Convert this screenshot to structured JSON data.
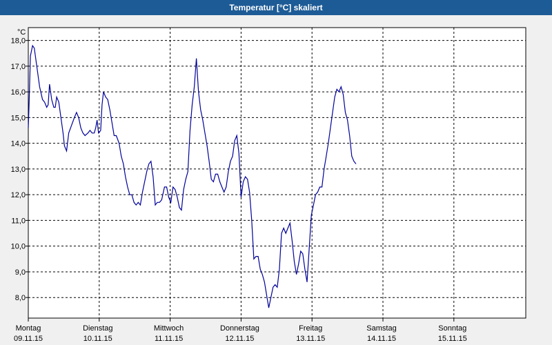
{
  "window": {
    "title": "Temperatur [°C] skaliert"
  },
  "colors": {
    "line": "#000099",
    "titlebar": "#1d5b96",
    "grid": "#000000",
    "background": "#f0f0f0"
  },
  "chart_data": {
    "type": "line",
    "title": "Temperatur [°C] skaliert",
    "ylabel": "°C",
    "ylim": [
      7.2,
      18.5
    ],
    "yticks": [
      {
        "value": 8,
        "label": "8,0"
      },
      {
        "value": 9,
        "label": "9,0"
      },
      {
        "value": 10,
        "label": "10,0"
      },
      {
        "value": 11,
        "label": "11,0"
      },
      {
        "value": 12,
        "label": "12,0"
      },
      {
        "value": 13,
        "label": "13,0"
      },
      {
        "value": 14,
        "label": "14,0"
      },
      {
        "value": 15,
        "label": "15,0"
      },
      {
        "value": 16,
        "label": "16,0"
      },
      {
        "value": 17,
        "label": "17,0"
      },
      {
        "value": 18,
        "label": "18,0"
      }
    ],
    "xlim": [
      0,
      7
    ],
    "x_unit": "days from 09.11.15 00:00",
    "xticks": [
      {
        "value": 0,
        "day": "Montag",
        "date": "09.11.15"
      },
      {
        "value": 1,
        "day": "Dienstag",
        "date": "10.11.15"
      },
      {
        "value": 2,
        "day": "Mittwoch",
        "date": "11.11.15"
      },
      {
        "value": 3,
        "day": "Donnerstag",
        "date": "12.11.15"
      },
      {
        "value": 4,
        "day": "Freitag",
        "date": "13.11.15"
      },
      {
        "value": 5,
        "day": "Samstag",
        "date": "14.11.15"
      },
      {
        "value": 6,
        "day": "Sonntag",
        "date": "15.11.15"
      }
    ],
    "grid": true,
    "series": [
      {
        "points": [
          [
            0.0,
            14.6
          ],
          [
            0.01,
            15.4
          ],
          [
            0.03,
            17.4
          ],
          [
            0.06,
            17.8
          ],
          [
            0.085,
            17.7
          ],
          [
            0.12,
            17.0
          ],
          [
            0.16,
            16.2
          ],
          [
            0.2,
            15.7
          ],
          [
            0.23,
            15.6
          ],
          [
            0.26,
            15.4
          ],
          [
            0.28,
            15.5
          ],
          [
            0.3,
            16.3
          ],
          [
            0.33,
            15.7
          ],
          [
            0.36,
            15.4
          ],
          [
            0.38,
            15.4
          ],
          [
            0.4,
            15.8
          ],
          [
            0.43,
            15.6
          ],
          [
            0.46,
            15.0
          ],
          [
            0.49,
            14.4
          ],
          [
            0.51,
            13.9
          ],
          [
            0.54,
            13.7
          ],
          [
            0.57,
            14.4
          ],
          [
            0.61,
            14.7
          ],
          [
            0.65,
            15.0
          ],
          [
            0.68,
            15.2
          ],
          [
            0.71,
            15.0
          ],
          [
            0.74,
            14.6
          ],
          [
            0.77,
            14.4
          ],
          [
            0.8,
            14.3
          ],
          [
            0.84,
            14.4
          ],
          [
            0.87,
            14.5
          ],
          [
            0.9,
            14.4
          ],
          [
            0.93,
            14.4
          ],
          [
            0.95,
            14.6
          ],
          [
            0.97,
            14.9
          ],
          [
            0.99,
            14.4
          ],
          [
            1.02,
            14.5
          ],
          [
            1.04,
            15.5
          ],
          [
            1.06,
            16.0
          ],
          [
            1.09,
            15.8
          ],
          [
            1.12,
            15.7
          ],
          [
            1.15,
            15.3
          ],
          [
            1.18,
            14.8
          ],
          [
            1.21,
            14.3
          ],
          [
            1.24,
            14.3
          ],
          [
            1.28,
            14.0
          ],
          [
            1.31,
            13.5
          ],
          [
            1.34,
            13.2
          ],
          [
            1.37,
            12.7
          ],
          [
            1.4,
            12.3
          ],
          [
            1.43,
            12.0
          ],
          [
            1.46,
            12.0
          ],
          [
            1.49,
            11.7
          ],
          [
            1.52,
            11.6
          ],
          [
            1.55,
            11.7
          ],
          [
            1.58,
            11.6
          ],
          [
            1.61,
            12.1
          ],
          [
            1.64,
            12.5
          ],
          [
            1.67,
            12.9
          ],
          [
            1.7,
            13.2
          ],
          [
            1.73,
            13.3
          ],
          [
            1.76,
            12.7
          ],
          [
            1.79,
            11.6
          ],
          [
            1.82,
            11.7
          ],
          [
            1.85,
            11.7
          ],
          [
            1.88,
            11.8
          ],
          [
            1.92,
            12.3
          ],
          [
            1.95,
            12.3
          ],
          [
            1.98,
            11.9
          ],
          [
            2.01,
            11.7
          ],
          [
            2.04,
            12.3
          ],
          [
            2.07,
            12.2
          ],
          [
            2.1,
            11.9
          ],
          [
            2.13,
            11.5
          ],
          [
            2.16,
            11.4
          ],
          [
            2.19,
            12.2
          ],
          [
            2.22,
            12.6
          ],
          [
            2.25,
            12.9
          ],
          [
            2.28,
            14.5
          ],
          [
            2.31,
            15.5
          ],
          [
            2.34,
            16.2
          ],
          [
            2.37,
            17.3
          ],
          [
            2.4,
            16.0
          ],
          [
            2.43,
            15.3
          ],
          [
            2.46,
            14.9
          ],
          [
            2.49,
            14.4
          ],
          [
            2.52,
            13.9
          ],
          [
            2.55,
            13.3
          ],
          [
            2.58,
            12.6
          ],
          [
            2.61,
            12.5
          ],
          [
            2.64,
            12.8
          ],
          [
            2.67,
            12.8
          ],
          [
            2.7,
            12.5
          ],
          [
            2.73,
            12.3
          ],
          [
            2.76,
            12.1
          ],
          [
            2.79,
            12.3
          ],
          [
            2.82,
            12.9
          ],
          [
            2.85,
            13.3
          ],
          [
            2.88,
            13.5
          ],
          [
            2.91,
            14.1
          ],
          [
            2.94,
            14.3
          ],
          [
            2.97,
            13.6
          ],
          [
            3.0,
            11.9
          ],
          [
            3.03,
            12.5
          ],
          [
            3.06,
            12.7
          ],
          [
            3.09,
            12.6
          ],
          [
            3.12,
            12.1
          ],
          [
            3.15,
            11.0
          ],
          [
            3.18,
            9.5
          ],
          [
            3.21,
            9.6
          ],
          [
            3.24,
            9.6
          ],
          [
            3.27,
            9.1
          ],
          [
            3.3,
            8.9
          ],
          [
            3.33,
            8.6
          ],
          [
            3.36,
            8.1
          ],
          [
            3.39,
            7.6
          ],
          [
            3.42,
            8.0
          ],
          [
            3.45,
            8.4
          ],
          [
            3.48,
            8.5
          ],
          [
            3.51,
            8.4
          ],
          [
            3.54,
            9.1
          ],
          [
            3.57,
            10.5
          ],
          [
            3.6,
            10.7
          ],
          [
            3.63,
            10.5
          ],
          [
            3.66,
            10.7
          ],
          [
            3.69,
            10.9
          ],
          [
            3.72,
            10.2
          ],
          [
            3.75,
            9.4
          ],
          [
            3.78,
            8.9
          ],
          [
            3.81,
            9.3
          ],
          [
            3.84,
            9.8
          ],
          [
            3.87,
            9.7
          ],
          [
            3.9,
            9.1
          ],
          [
            3.93,
            8.6
          ],
          [
            3.96,
            9.9
          ],
          [
            3.99,
            11.2
          ],
          [
            4.02,
            11.6
          ],
          [
            4.05,
            12.0
          ],
          [
            4.08,
            12.1
          ],
          [
            4.11,
            12.3
          ],
          [
            4.14,
            12.3
          ],
          [
            4.17,
            13.0
          ],
          [
            4.2,
            13.5
          ],
          [
            4.23,
            14.0
          ],
          [
            4.26,
            14.6
          ],
          [
            4.29,
            15.2
          ],
          [
            4.32,
            15.8
          ],
          [
            4.35,
            16.1
          ],
          [
            4.38,
            16.0
          ],
          [
            4.41,
            16.2
          ],
          [
            4.44,
            15.9
          ],
          [
            4.47,
            15.2
          ],
          [
            4.5,
            14.9
          ],
          [
            4.53,
            14.3
          ],
          [
            4.56,
            13.5
          ],
          [
            4.59,
            13.3
          ],
          [
            4.62,
            13.2
          ]
        ]
      }
    ]
  }
}
